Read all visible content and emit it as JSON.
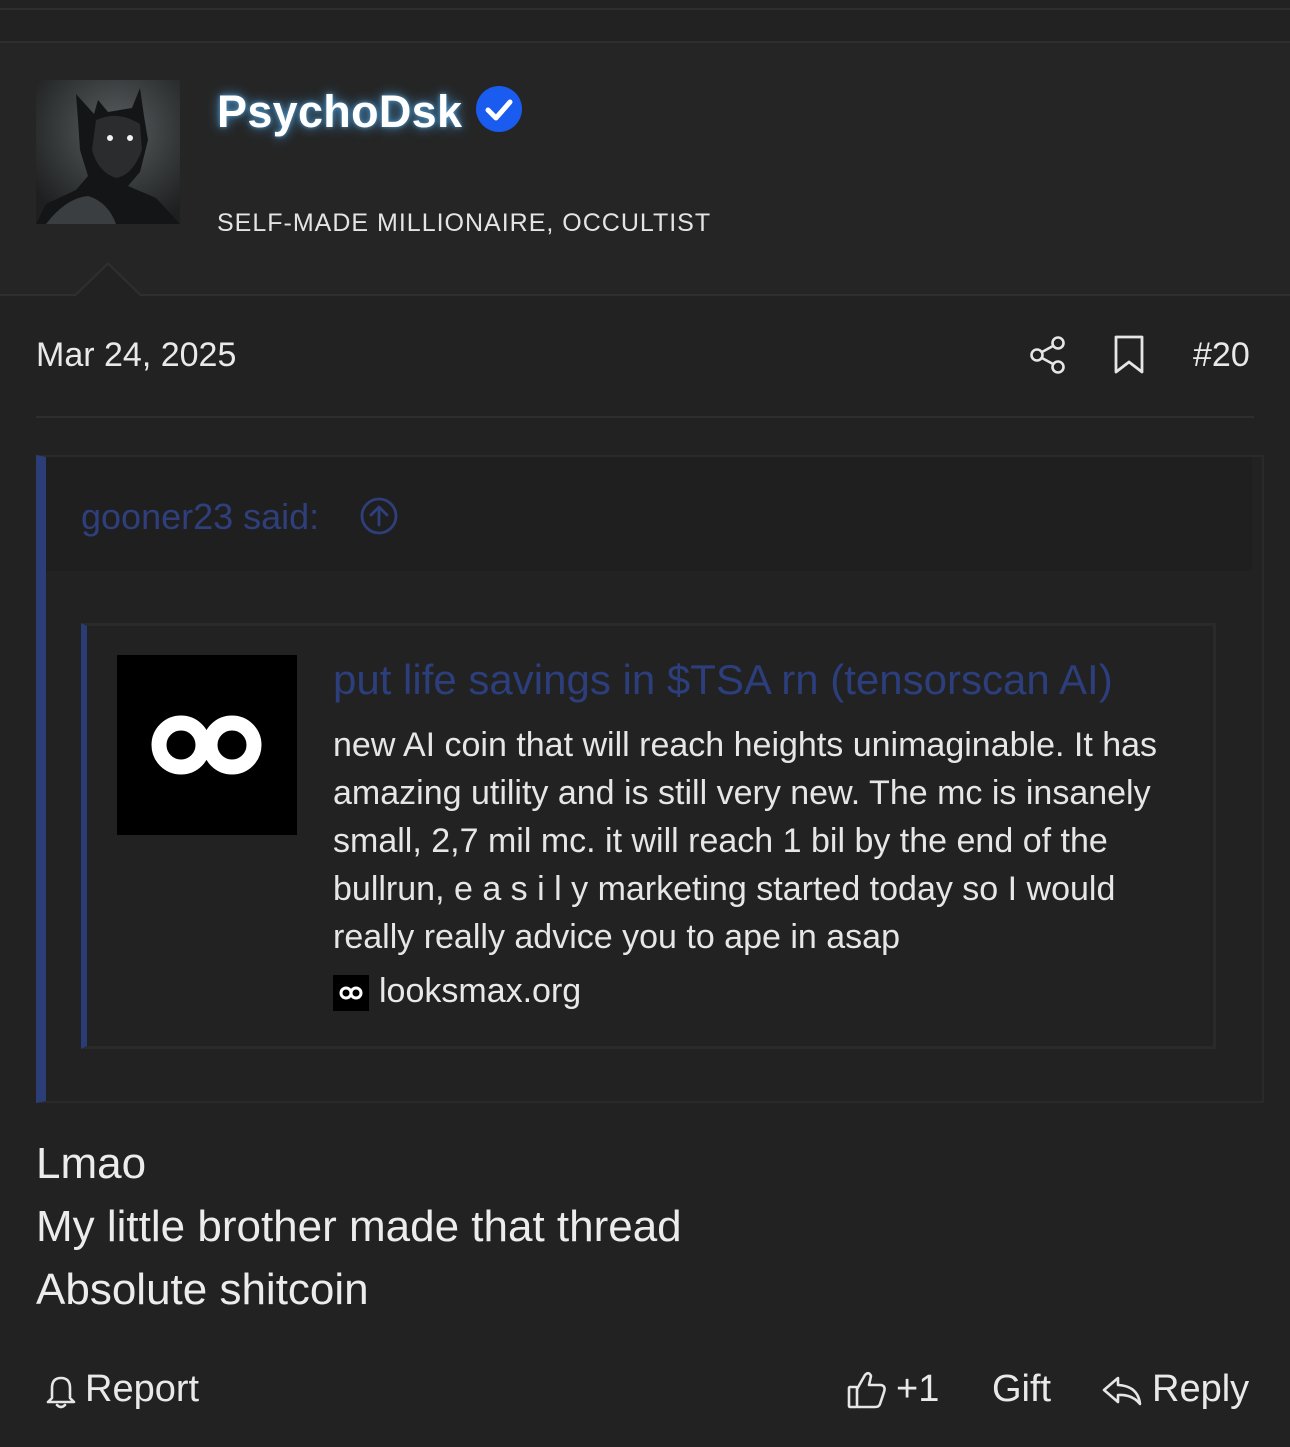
{
  "user": {
    "name": "PsychoDsk",
    "title": "SELF-MADE MILLIONAIRE, OCCULTIST"
  },
  "post": {
    "date": "Mar 24, 2025",
    "number": "#20",
    "body_lines": [
      "Lmao",
      "My little brother made that thread",
      "Absolute shitcoin"
    ]
  },
  "quote": {
    "author_label": "gooner23 said:",
    "embed": {
      "title": "put life savings in $TSA rn (tensorscan AI)",
      "description": "new AI coin that will reach heights unimaginable. It has amazing utility and is still very new. The mc is insanely small, 2,7 mil mc. it will reach 1 bil by the end of the bullrun, e a s i l y marketing started today so I would really really advice you to ape in asap",
      "domain": "looksmax.org"
    }
  },
  "actions": {
    "report": "Report",
    "like_count": "+1",
    "gift": "Gift",
    "reply": "Reply"
  },
  "colors": {
    "background": "#222222",
    "quote_accent": "#2c3e78",
    "verified": "#1a5cf0"
  }
}
